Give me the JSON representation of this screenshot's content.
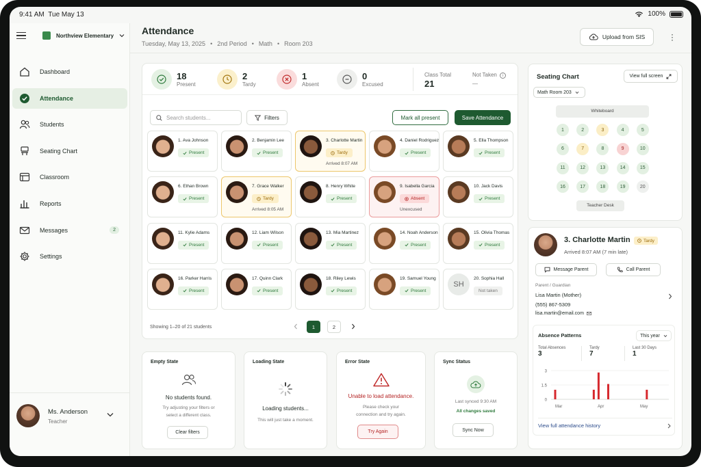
{
  "status_bar": {
    "time": "9:41 AM",
    "date": "Tue May 13",
    "battery": "100%"
  },
  "school": {
    "name": "Northview Elementary"
  },
  "nav": [
    {
      "label": "Dashboard",
      "icon": "home-icon"
    },
    {
      "label": "Attendance",
      "icon": "check-circle-icon",
      "active": true
    },
    {
      "label": "Students",
      "icon": "users-icon"
    },
    {
      "label": "Seating Chart",
      "icon": "seating-icon"
    },
    {
      "label": "Classroom",
      "icon": "classroom-icon"
    },
    {
      "label": "Reports",
      "icon": "bar-chart-icon"
    },
    {
      "label": "Messages",
      "icon": "mail-icon",
      "badge": "2"
    },
    {
      "label": "Settings",
      "icon": "gear-icon"
    }
  ],
  "user": {
    "name": "Ms. Anderson",
    "role": "Teacher"
  },
  "header": {
    "title": "Attendance",
    "date": "Tuesday, May 13, 2025",
    "period": "2nd Period",
    "subject": "Math",
    "room": "Room 203",
    "upload_label": "Upload from SIS"
  },
  "stats": {
    "present": {
      "value": "18",
      "label": "Present"
    },
    "tardy": {
      "value": "2",
      "label": "Tardy"
    },
    "absent": {
      "value": "1",
      "label": "Absent"
    },
    "excused": {
      "value": "0",
      "label": "Excused"
    },
    "class_total": {
      "label": "Class Total",
      "value": "21"
    },
    "not_taken": {
      "label": "Not Taken",
      "value": "—"
    }
  },
  "toolbar": {
    "search_placeholder": "Search students...",
    "filters": "Filters",
    "mark_all": "Mark all present",
    "save": "Save Attendance"
  },
  "students": [
    {
      "name": "1. Ava Johnson",
      "status": "Present",
      "type": "p"
    },
    {
      "name": "2. Benjamin Lee",
      "status": "Present",
      "type": "p"
    },
    {
      "name": "3. Charlotte Martin",
      "status": "Tardy",
      "type": "t",
      "note": "Arrived 8:07 AM"
    },
    {
      "name": "4. Daniel Rodriguez",
      "status": "Present",
      "type": "p"
    },
    {
      "name": "5. Ella Thompson",
      "status": "Present",
      "type": "p"
    },
    {
      "name": "6. Ethan Brown",
      "status": "Present",
      "type": "p"
    },
    {
      "name": "7. Grace Walker",
      "status": "Tardy",
      "type": "t",
      "note": "Arrived 8:05 AM"
    },
    {
      "name": "8. Henry White",
      "status": "Present",
      "type": "p"
    },
    {
      "name": "9. Isabella Garcia",
      "status": "Absent",
      "type": "a",
      "note": "Unexcused"
    },
    {
      "name": "10. Jack Davis",
      "status": "Present",
      "type": "p"
    },
    {
      "name": "11. Kylie Adams",
      "status": "Present",
      "type": "p"
    },
    {
      "name": "12. Liam Wilson",
      "status": "Present",
      "type": "p"
    },
    {
      "name": "13. Mia Martinez",
      "status": "Present",
      "type": "p"
    },
    {
      "name": "14. Noah Anderson",
      "status": "Present",
      "type": "p"
    },
    {
      "name": "15. Olivia Thomas",
      "status": "Present",
      "type": "p"
    },
    {
      "name": "16. Parker Harris",
      "status": "Present",
      "type": "p"
    },
    {
      "name": "17. Quinn Clark",
      "status": "Present",
      "type": "p"
    },
    {
      "name": "18. Riley Lewis",
      "status": "Present",
      "type": "p"
    },
    {
      "name": "19. Samuel Young",
      "status": "Present",
      "type": "p"
    },
    {
      "name": "20. Sophia Hall",
      "status": "Not taken",
      "type": "n",
      "initials": "SH"
    }
  ],
  "pagination": {
    "showing": "Showing 1–20 of 21 students",
    "pages": [
      "1",
      "2"
    ]
  },
  "states": {
    "empty": {
      "title": "Empty State",
      "heading": "No students found.",
      "text": "Try adjusting your filters or select a different class.",
      "button": "Clear filters"
    },
    "loading": {
      "title": "Loading State",
      "heading": "Loading students...",
      "text": "This will just take a moment."
    },
    "error": {
      "title": "Error State",
      "heading": "Unable to load attendance.",
      "text": "Please check your connection and try again.",
      "button": "Try Again"
    },
    "sync": {
      "title": "Sync Status",
      "last": "Last synced 9:30 AM",
      "saved": "All changes saved",
      "button": "Sync Now"
    }
  },
  "seating": {
    "title": "Seating Chart",
    "view_full": "View full screen",
    "room": "Math Room 203",
    "whiteboard": "Whiteboard",
    "desk": "Teacher Desk",
    "seats": [
      "1",
      "2",
      "3",
      "4",
      "5",
      "6",
      "7",
      "8",
      "9",
      "10",
      "11",
      "12",
      "13",
      "14",
      "15",
      "16",
      "17",
      "18",
      "19",
      "20"
    ],
    "seat_status": [
      "p",
      "p",
      "t",
      "p",
      "p",
      "p",
      "t",
      "p",
      "a",
      "p",
      "p",
      "p",
      "p",
      "p",
      "p",
      "p",
      "p",
      "p",
      "p",
      "n"
    ]
  },
  "detail": {
    "name": "3. Charlotte Martin",
    "badge": "Tardy",
    "arrived": "Arrived 8:07 AM (7 min late)",
    "message": "Message Parent",
    "call": "Call Parent",
    "guardian_label": "Parent / Guardian",
    "guardian": "Lisa Martin (Mother)",
    "phone": "(555) 867-5309",
    "email": "lisa.martin@email.com"
  },
  "absence": {
    "title": "Absence Patterns",
    "range": "This year",
    "stats": [
      {
        "label": "Total Absences",
        "value": "3"
      },
      {
        "label": "Tardy",
        "value": "7"
      },
      {
        "label": "Last 30 Days",
        "value": "1"
      }
    ],
    "history_link": "View full attendance history"
  },
  "chart_data": {
    "type": "bar",
    "title": "Absence Patterns",
    "ylim": [
      0,
      3
    ],
    "yticks": [
      "3",
      "1.5",
      "0"
    ],
    "xticks": [
      "Mar",
      "Apr",
      "May"
    ],
    "values": [
      1,
      0,
      0,
      0,
      0,
      0,
      0,
      0,
      1,
      2.8,
      0,
      1.6,
      0,
      0,
      0,
      0,
      0,
      0,
      0,
      1,
      0,
      0,
      0,
      0
    ]
  }
}
